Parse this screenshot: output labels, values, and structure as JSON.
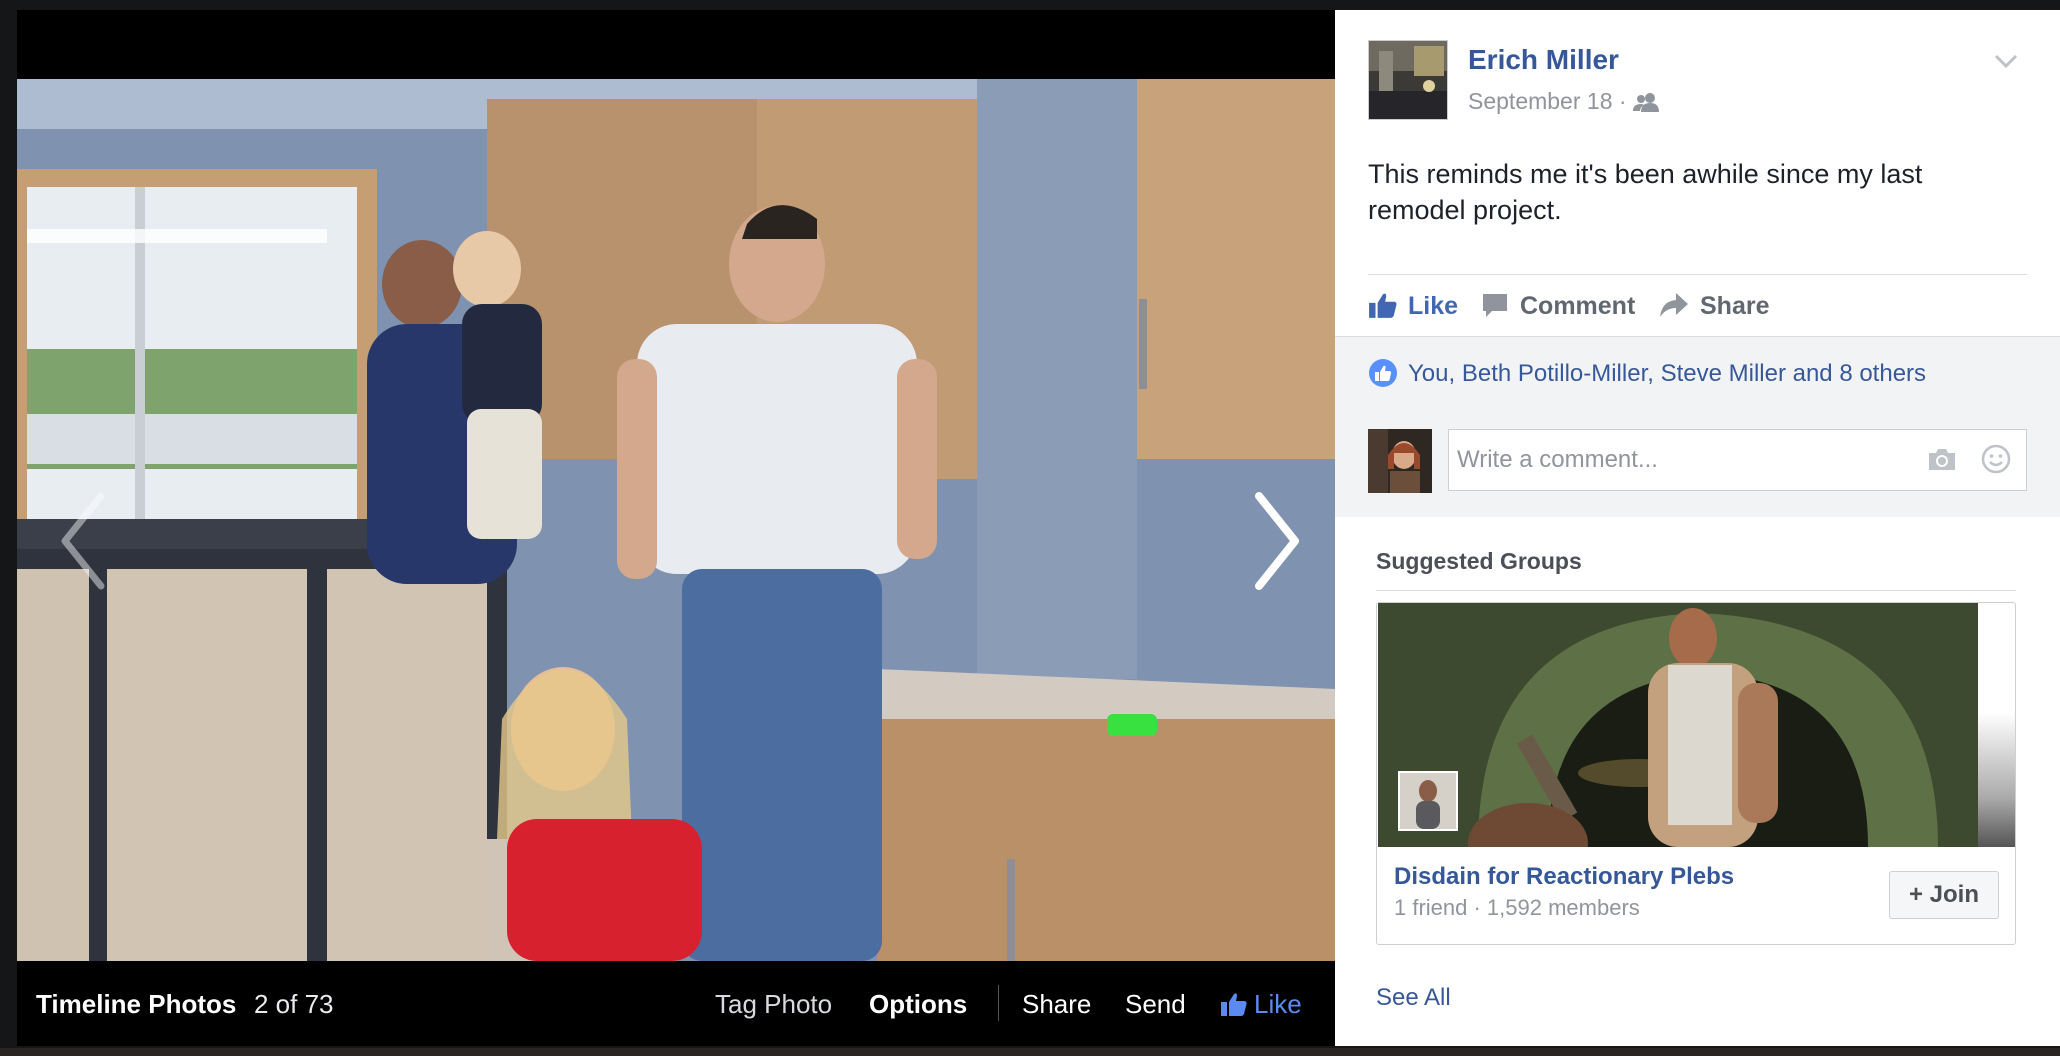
{
  "viewer": {
    "album_title": "Timeline Photos",
    "photo_counter": "2 of 73",
    "actions": {
      "tag_photo": "Tag Photo",
      "options": "Options",
      "share": "Share",
      "send": "Send",
      "like": "Like"
    },
    "prev_icon": "chevron-left-icon",
    "next_icon": "chevron-right-icon"
  },
  "post": {
    "author": "Erich Miller",
    "date": "September 18",
    "date_separator": "·",
    "audience_icon": "friends-icon",
    "text": "This reminds me it's been awhile since my last remodel project.",
    "actions": {
      "like": "Like",
      "comment": "Comment",
      "share": "Share"
    },
    "likes_summary": "You, Beth Potillo-Miller, Steve Miller and 8 others",
    "comment_placeholder": "Write a comment...",
    "link_color": "#365899",
    "like_color": "#4267b2"
  },
  "suggested_groups": {
    "title": "Suggested Groups",
    "groups": [
      {
        "name": "Disdain for Reactionary Plebs",
        "stats": "1 friend · 1,592 members",
        "join_label": "+ Join"
      }
    ],
    "see_all": "See All"
  }
}
